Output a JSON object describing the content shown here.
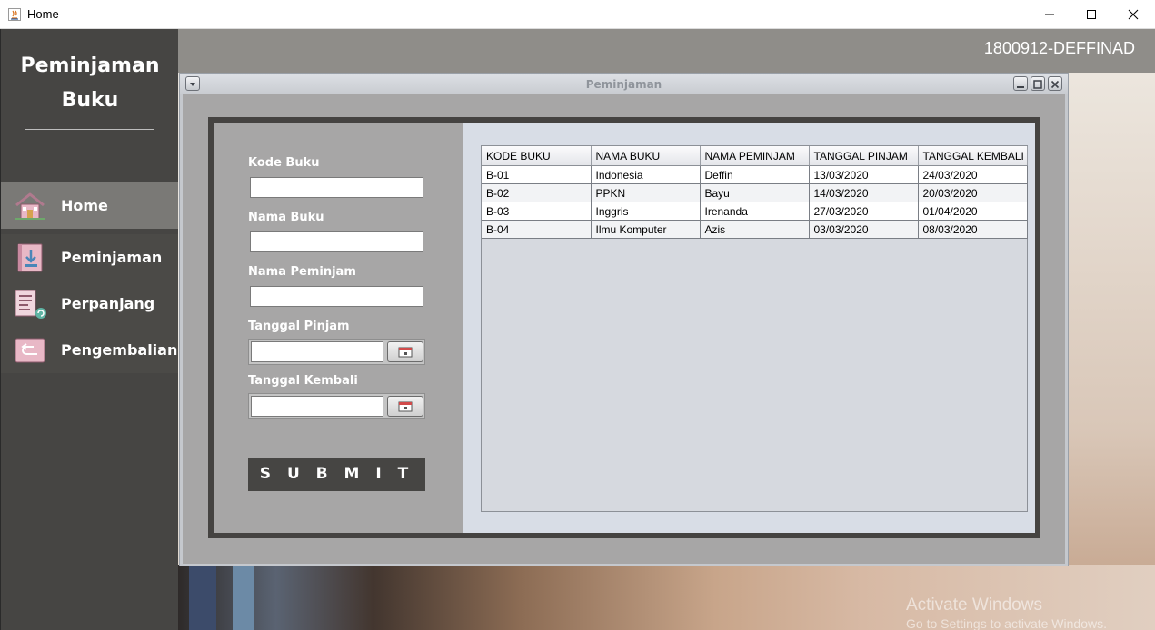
{
  "window": {
    "title": "Home"
  },
  "sidebar": {
    "brand_line1": "Peminjaman",
    "brand_line2": "Buku",
    "items": [
      {
        "label": "Home",
        "icon": "home-icon",
        "active": true
      },
      {
        "label": "Peminjaman",
        "icon": "download-book-icon",
        "active": false
      },
      {
        "label": "Perpanjang",
        "icon": "document-renew-icon",
        "active": false
      },
      {
        "label": "Pengembalian",
        "icon": "return-arrow-icon",
        "active": false
      }
    ]
  },
  "header": {
    "user": "1800912-DEFFINAD"
  },
  "internal_frame": {
    "title": "Peminjaman"
  },
  "form": {
    "kode_buku_label": "Kode Buku",
    "kode_buku_value": "",
    "nama_buku_label": "Nama Buku",
    "nama_buku_value": "",
    "nama_peminjam_label": "Nama Peminjam",
    "nama_peminjam_value": "",
    "tanggal_pinjam_label": "Tanggal Pinjam",
    "tanggal_pinjam_value": "",
    "tanggal_kembali_label": "Tanggal Kembali",
    "tanggal_kembali_value": "",
    "submit_label": "S U B M I T"
  },
  "table": {
    "columns": [
      "KODE BUKU",
      "NAMA BUKU",
      "NAMA PEMINJAM",
      "TANGGAL PINJAM",
      "TANGGAL KEMBALI"
    ],
    "rows": [
      [
        "B-01",
        "Indonesia",
        "Deffin",
        "13/03/2020",
        "24/03/2020"
      ],
      [
        "B-02",
        "PPKN",
        "Bayu",
        "14/03/2020",
        "20/03/2020"
      ],
      [
        "B-03",
        "Inggris",
        "Irenanda",
        "27/03/2020",
        "01/04/2020"
      ],
      [
        "B-04",
        "Ilmu Komputer",
        "Azis",
        "03/03/2020",
        "08/03/2020"
      ]
    ]
  },
  "watermark": {
    "line1": "Activate Windows",
    "line2": "Go to Settings to activate Windows."
  },
  "colors": {
    "sidebar": "#464543",
    "sidebar_active": "#7a7976",
    "submit": "#464543",
    "table_bg": "#d8dde6"
  }
}
